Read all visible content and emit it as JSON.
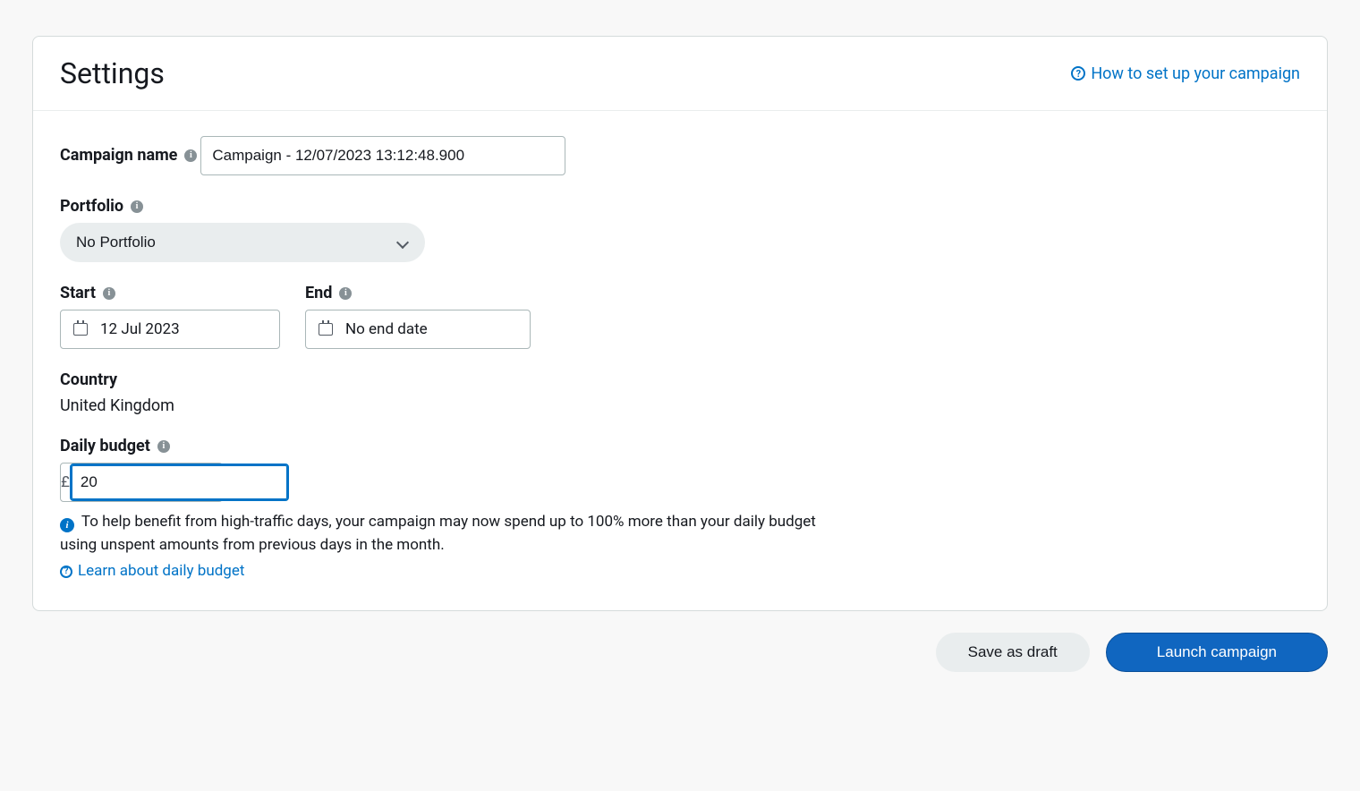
{
  "header": {
    "title": "Settings",
    "help_link": "How to set up your campaign"
  },
  "campaign_name": {
    "label": "Campaign name",
    "value": "Campaign - 12/07/2023 13:12:48.900"
  },
  "portfolio": {
    "label": "Portfolio",
    "selected": "No Portfolio"
  },
  "start": {
    "label": "Start",
    "value": "12 Jul 2023"
  },
  "end": {
    "label": "End",
    "value": "No end date"
  },
  "country": {
    "label": "Country",
    "value": "United Kingdom"
  },
  "budget": {
    "label": "Daily budget",
    "currency": "£",
    "value": "20",
    "info_text": "To help benefit from high-traffic days, your campaign may now spend up to 100% more than your daily budget using unspent amounts from previous days in the month.",
    "learn_link": "Learn about daily budget"
  },
  "actions": {
    "save_draft": "Save as draft",
    "launch": "Launch campaign"
  }
}
